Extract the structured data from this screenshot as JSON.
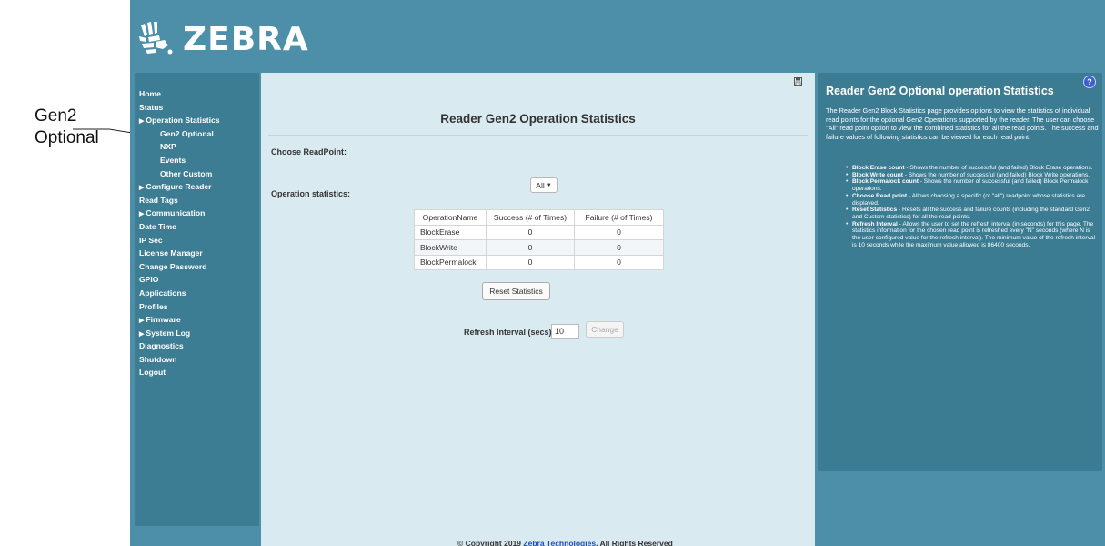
{
  "callout": {
    "label_line1": "Gen2",
    "label_line2": "Optional"
  },
  "brand": {
    "name": "ZEBRA",
    "accent": "#4d8fa8"
  },
  "sidebar": {
    "items": [
      {
        "label": "Home",
        "arrow": false,
        "sub": false
      },
      {
        "label": "Status",
        "arrow": false,
        "sub": false
      },
      {
        "label": "Operation Statistics",
        "arrow": true,
        "sub": false
      },
      {
        "label": "Gen2 Optional",
        "arrow": false,
        "sub": true,
        "active": true
      },
      {
        "label": "NXP",
        "arrow": false,
        "sub": true
      },
      {
        "label": "Events",
        "arrow": false,
        "sub": true
      },
      {
        "label": "Other Custom",
        "arrow": false,
        "sub": true
      },
      {
        "label": "Configure Reader",
        "arrow": true,
        "sub": false
      },
      {
        "label": "Read Tags",
        "arrow": false,
        "sub": false
      },
      {
        "label": "Communication",
        "arrow": true,
        "sub": false
      },
      {
        "label": "Date Time",
        "arrow": false,
        "sub": false
      },
      {
        "label": "IP Sec",
        "arrow": false,
        "sub": false
      },
      {
        "label": "License Manager",
        "arrow": false,
        "sub": false
      },
      {
        "label": "Change Password",
        "arrow": false,
        "sub": false
      },
      {
        "label": "GPIO",
        "arrow": false,
        "sub": false
      },
      {
        "label": "Applications",
        "arrow": false,
        "sub": false
      },
      {
        "label": "Profiles",
        "arrow": false,
        "sub": false
      },
      {
        "label": "Firmware",
        "arrow": true,
        "sub": false
      },
      {
        "label": "System Log",
        "arrow": true,
        "sub": false
      },
      {
        "label": "Diagnostics",
        "arrow": false,
        "sub": false
      },
      {
        "label": "Shutdown",
        "arrow": false,
        "sub": false
      },
      {
        "label": "Logout",
        "arrow": false,
        "sub": false
      }
    ]
  },
  "main": {
    "title": "Reader Gen2 Operation Statistics",
    "choose_readpoint_label": "Choose ReadPoint:",
    "readpoint_value": "All",
    "op_stats_label": "Operation statistics:",
    "table": {
      "headers": [
        "OperationName",
        "Success (# of Times)",
        "Failure (# of Times)"
      ],
      "rows": [
        [
          "BlockErase",
          "0",
          "0"
        ],
        [
          "BlockWrite",
          "0",
          "0"
        ],
        [
          "BlockPermalock",
          "0",
          "0"
        ]
      ]
    },
    "reset_label": "Reset Statistics",
    "refresh_label": "Refresh Interval (secs):",
    "refresh_value": "10",
    "change_label": "Change",
    "footer_prefix": "© Copyright 2019 ",
    "footer_link": "Zebra Technologies",
    "footer_suffix": ", All Rights Reserved"
  },
  "help": {
    "icon": "?",
    "title": "Reader Gen2 Optional operation Statistics",
    "intro": "The Reader Gen2 Block Statistics page provides options to view the statistics of individual read points for the optional Gen2 Operations supported by the reader. The user can choose \"All\" read point option to view the combined statistics for all the read points. The success and failure values of following statistics can be viewed for each read point.",
    "items": [
      {
        "term": "Block Erase count",
        "desc": " - Shows the number of successful (and failed) Block Erase operations."
      },
      {
        "term": "Block Write count",
        "desc": " - Shows the number of successful (and failed) Block Write operations."
      },
      {
        "term": "Block Permalock count",
        "desc": " - Shows the number of successful (and failed) Block Permalock operations."
      },
      {
        "term": "Choose Read point",
        "desc": " - Allows choosing a specific (or \"all\") readpoint whose statistics are displayed."
      },
      {
        "term": "Reset Statistics",
        "desc": " - Resets all the success and failure counts (including the standard Gen2 and Custom statistics) for all the read points."
      },
      {
        "term": "Refresh Interval",
        "desc": " - Allows the user to set the refresh interval (in seconds) for this page. The statistics information for the chosen read point is refreshed every \"N\" seconds (where N is the user configured value for the refresh interval). The minimum value of the refresh interval is 10 seconds while the maximum value allowed is 86400 seconds."
      }
    ]
  }
}
